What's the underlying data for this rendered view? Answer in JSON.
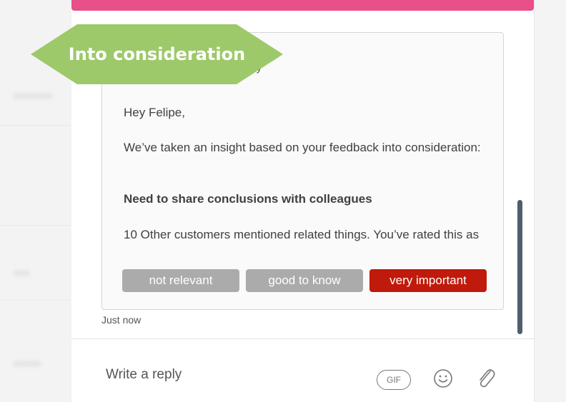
{
  "card": {
    "header_text": "tory",
    "greeting": "Hey Felipe,",
    "message": "We’ve taken an insight based on your feedback into consideration:",
    "insight": "Need to share conclusions with colleagues",
    "related": "10 Other customers mentioned related things. You’ve rated this as",
    "ratings": [
      {
        "label": "not relevant",
        "selected": false
      },
      {
        "label": "good to know",
        "selected": false
      },
      {
        "label": "very important",
        "selected": true
      }
    ]
  },
  "timestamp": "Just now",
  "composer": {
    "placeholder": "Write a reply",
    "gif_label": "GIF",
    "emoji_icon": "smiley-icon",
    "attach_icon": "paperclip-icon"
  },
  "banner": {
    "text": "Into consideration",
    "color": "#9dc96a"
  },
  "colors": {
    "accent_bar": "#e8508a",
    "selected_rating": "#c01a0c",
    "unselected_rating": "#ababab",
    "scrollbar": "#4e5e6e"
  }
}
